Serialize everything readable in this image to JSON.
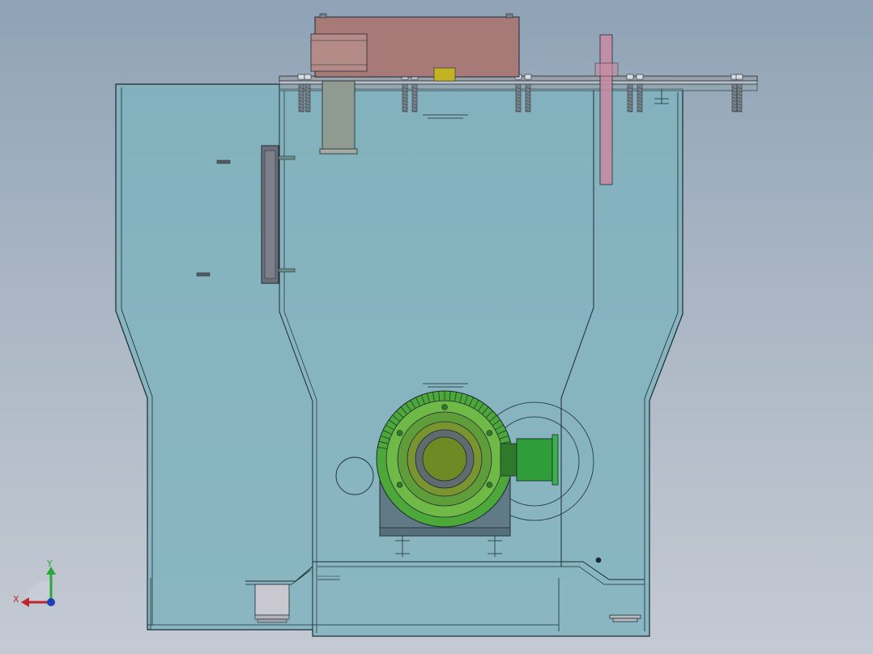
{
  "view": {
    "type": "cad-assembly-front-view",
    "background_top": "#8fa3b6",
    "background_bottom": "#c4cad3"
  },
  "colors": {
    "tank_fill": "#7fb3bd",
    "tank_stroke": "#1d2a33",
    "motor_block": "#a77a78",
    "motor_cylinder": "#b58b88",
    "pipe": "#8f9a90",
    "rod": "#c88aa2",
    "flange_bar": "#9aa0a8",
    "gear_green": "#4da83a",
    "gear_dark": "#2f7a2a",
    "gear_yellow": "#7a8f1e",
    "gear_housing": "#607b86",
    "gearmotor": "#2f9e3a",
    "hopper_cup": "#c9c7cf",
    "yellow_tag": "#c3b324",
    "axis_x": "#c0262c",
    "axis_y": "#2aa83a",
    "axis_z": "#1f3fb8"
  },
  "components": [
    "tank-body",
    "motor-housing",
    "motor-cylinder",
    "inlet-pipe",
    "pink-rod",
    "top-flange-rail",
    "side-access-door",
    "worm-gear-wheel",
    "gearmotor",
    "gear-housing",
    "outlet-cup"
  ],
  "axes": {
    "x_label": "X",
    "y_label": "Y"
  }
}
